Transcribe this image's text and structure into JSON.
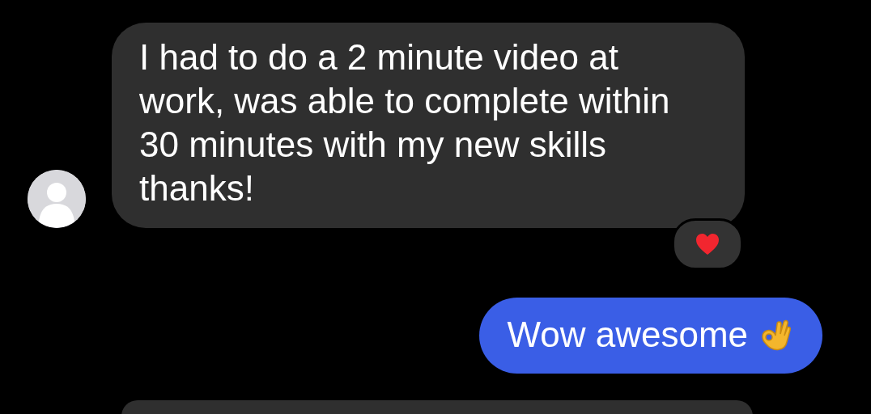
{
  "messages": [
    {
      "kind": "incoming",
      "text": "I had to do a 2 minute video at work, was able to complete within 30 minutes with my new skills thanks!",
      "reacted": true
    },
    {
      "kind": "outgoing",
      "text": "Wow awesome"
    },
    {
      "kind": "partial"
    }
  ]
}
